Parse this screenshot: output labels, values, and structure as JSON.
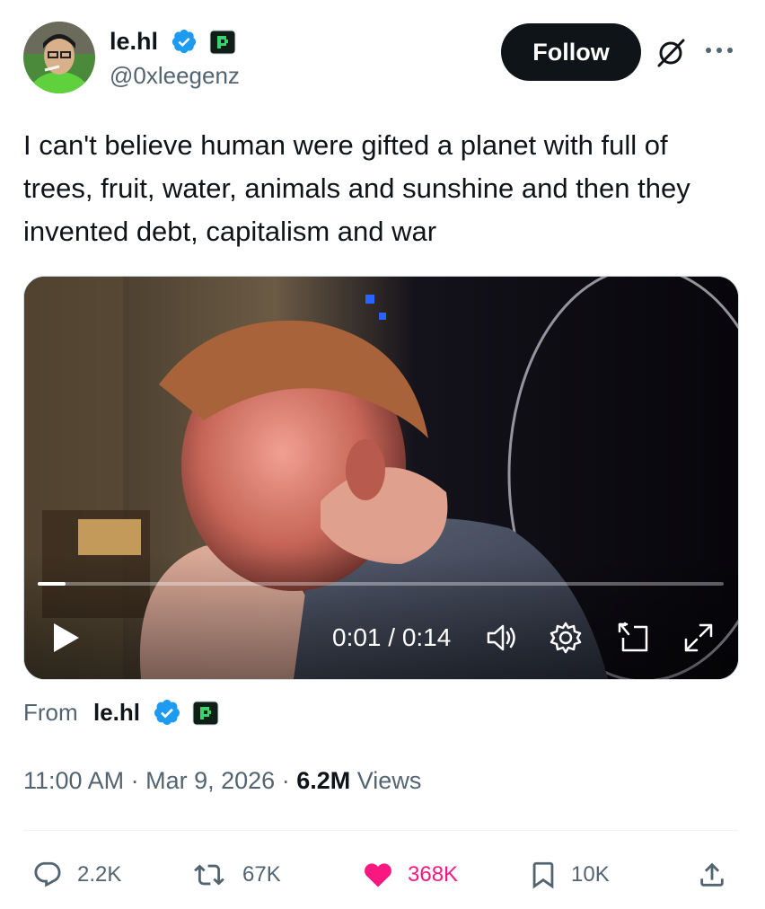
{
  "author": {
    "name": "le.hl",
    "handle": "@0xleegenz",
    "follow_label": "Follow"
  },
  "tweet": {
    "text": "I can't believe human were gifted a planet with full of trees, fruit, water, animals and sunshine and then they invented debt, capitalism and war"
  },
  "video": {
    "time": "0:01 / 0:14",
    "progress": 0.04
  },
  "source": {
    "prefix": "From",
    "name": "le.hl"
  },
  "meta": {
    "time": "11:00 AM",
    "sep1": "·",
    "date": "Mar 9, 2026",
    "sep2": "·",
    "views_count": "6.2M",
    "views_label": "Views"
  },
  "actions": {
    "replies": "2.2K",
    "reposts": "67K",
    "likes": "368K",
    "bookmarks": "10K"
  },
  "colors": {
    "verified": "#1d9bf0",
    "like": "#f91880",
    "muted": "#536471",
    "text": "#0f1419"
  },
  "icons": [
    "verified-badge-icon",
    "affiliate-badge-icon",
    "grok-icon",
    "more-icon",
    "play-icon",
    "volume-icon",
    "settings-icon",
    "pip-icon",
    "fullscreen-icon",
    "reply-icon",
    "repost-icon",
    "like-icon",
    "bookmark-icon",
    "share-icon"
  ]
}
